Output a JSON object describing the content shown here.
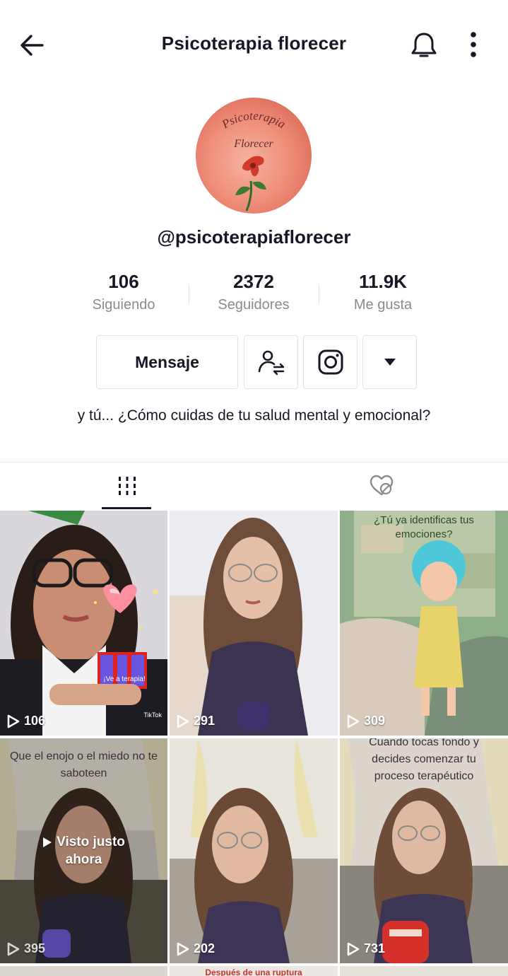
{
  "header": {
    "title": "Psicoterapia florecer",
    "icons": {
      "back": "arrow-left-icon",
      "notifications": "bell-icon",
      "more": "more-vertical-icon"
    }
  },
  "profile": {
    "avatar_text_line1": "Psicoterapia",
    "avatar_text_line2": "Florecer",
    "handle": "@psicoterapiaflorecer",
    "bio": "y tú... ¿Cómo cuidas de tu salud mental y emocional?"
  },
  "stats": {
    "following": {
      "value": "106",
      "label": "Siguiendo"
    },
    "followers": {
      "value": "2372",
      "label": "Seguidores"
    },
    "likes": {
      "value": "11.9K",
      "label": "Me gusta"
    }
  },
  "actions": {
    "message_label": "Mensaje",
    "icons": {
      "friend": "user-swap-icon",
      "instagram": "instagram-icon",
      "dropdown": "caret-down-icon"
    }
  },
  "tabs": [
    {
      "name": "videos",
      "icon": "grid-bars-icon",
      "active": true
    },
    {
      "name": "liked",
      "icon": "heart-hidden-icon",
      "active": false
    }
  ],
  "videos": [
    {
      "views": "106",
      "overlay": "¡Ve a terapia!",
      "watermark": "TikTok"
    },
    {
      "views": "291"
    },
    {
      "views": "309",
      "overlay": "¿Tú ya identificas tus emociones?"
    },
    {
      "views": "395",
      "overlay": "Que el enojo o el miedo no te saboteen",
      "status_line1": "Visto justo",
      "status_line2": "ahora"
    },
    {
      "views": "202"
    },
    {
      "views": "731",
      "overlay": "Cuando tocas fondo y decides comenzar tu proceso terapéutico"
    }
  ],
  "next_row_peek": "Después de una ruptura",
  "colors": {
    "text": "#161823",
    "secondary": "#8a8b91",
    "border": "#e3e3e4"
  }
}
